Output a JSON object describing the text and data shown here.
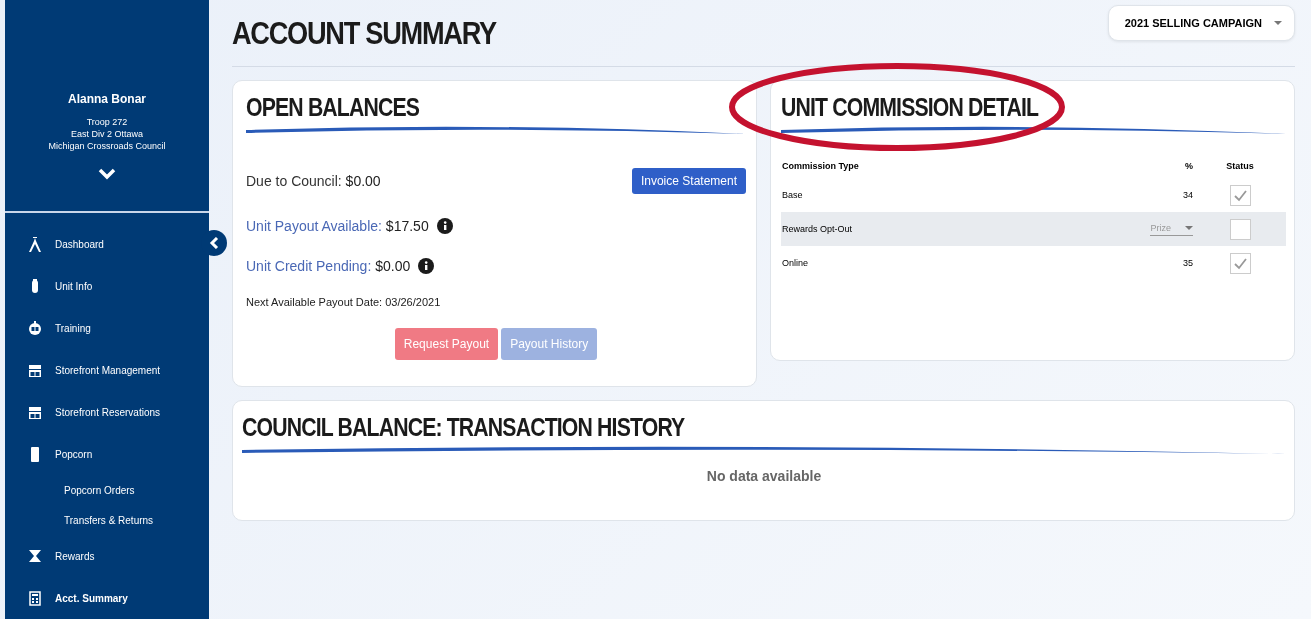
{
  "sidebar": {
    "user": {
      "name": "Alanna Bonar",
      "details": [
        "Troop 272",
        "East Div 2 Ottawa",
        "Michigan Crossroads Council"
      ]
    },
    "nav": [
      {
        "label": "Dashboard",
        "selected": false
      },
      {
        "label": "Unit Info",
        "selected": false
      },
      {
        "label": "Training",
        "selected": false
      },
      {
        "label": "Storefront Management",
        "selected": false
      },
      {
        "label": "Storefront Reservations",
        "selected": false
      },
      {
        "label": "Popcorn",
        "selected": false,
        "children": [
          {
            "label": "Popcorn Orders",
            "selected": false
          },
          {
            "label": "Transfers & Returns",
            "selected": false
          }
        ]
      },
      {
        "label": "Rewards",
        "selected": false
      },
      {
        "label": "Acct. Summary",
        "selected": true
      }
    ]
  },
  "page": {
    "title": "ACCOUNT SUMMARY",
    "campaign": "2021 SELLING CAMPAIGN"
  },
  "open_balances": {
    "title": "OPEN BALANCES",
    "lines": [
      {
        "label": "Due to Council:",
        "value": "$0.00",
        "link": false,
        "info": false
      },
      {
        "label": "Unit Payout Available:",
        "value": "$17.50",
        "link": true,
        "info": true
      },
      {
        "label": "Unit Credit Pending:",
        "value": "$0.00",
        "link": true,
        "info": true
      }
    ],
    "invoice_button": "Invoice Statement",
    "next_payout": "Next Available Payout Date: 03/26/2021",
    "buttons": [
      {
        "label": "Request Payout",
        "disabled": false
      },
      {
        "label": "Payout History",
        "disabled": true
      }
    ]
  },
  "commission": {
    "title": "UNIT COMMISSION DETAIL",
    "circled": true,
    "columns": [
      "Commission Type",
      "%",
      "Status"
    ],
    "rows": [
      {
        "type": "Base",
        "kind": "value",
        "percent": "34",
        "checked": true,
        "highlighted": false
      },
      {
        "type": "Rewards Opt-Out",
        "kind": "dropdown",
        "percent": "Prize",
        "checked": false,
        "highlighted": true
      },
      {
        "type": "Online",
        "kind": "value",
        "percent": "35",
        "checked": true,
        "highlighted": false
      }
    ]
  },
  "transactions": {
    "title": "COUNCIL BALANCE: TRANSACTION HISTORY",
    "empty": "No data available"
  }
}
